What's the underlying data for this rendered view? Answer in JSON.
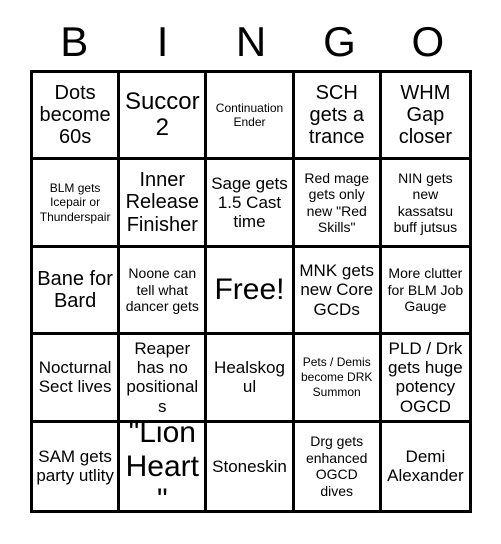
{
  "card": {
    "title": "BINGO",
    "header_letters": [
      "B",
      "I",
      "N",
      "G",
      "O"
    ],
    "free_space_label": "Free!",
    "colors": {
      "background": "#ffffff",
      "border": "#000000",
      "text": "#000000"
    },
    "grid_size": "5x5",
    "cells": [
      {
        "text": "Dots become 60s",
        "size": "lg",
        "column": "B",
        "row": 1
      },
      {
        "text": "Succor 2",
        "size": "xl",
        "column": "I",
        "row": 1
      },
      {
        "text": "Continuation Ender",
        "size": "xs",
        "column": "N",
        "row": 1
      },
      {
        "text": "SCH gets a trance",
        "size": "lg",
        "column": "G",
        "row": 1
      },
      {
        "text": "WHM Gap closer",
        "size": "lg",
        "column": "O",
        "row": 1
      },
      {
        "text": "BLM gets Icepair or Thunderspair",
        "size": "xs",
        "column": "B",
        "row": 2
      },
      {
        "text": "Inner Release Finisher",
        "size": "lg",
        "column": "I",
        "row": 2
      },
      {
        "text": "Sage gets 1.5 Cast time",
        "size": "md",
        "column": "N",
        "row": 2
      },
      {
        "text": "Red mage gets only new \"Red Skills\"",
        "size": "sm",
        "column": "G",
        "row": 2
      },
      {
        "text": "NIN gets new kassatsu buff jutsus",
        "size": "sm",
        "column": "O",
        "row": 2
      },
      {
        "text": "Bane for Bard",
        "size": "lg",
        "column": "B",
        "row": 3
      },
      {
        "text": "Noone can tell what dancer gets",
        "size": "sm",
        "column": "I",
        "row": 3
      },
      {
        "text": "Free!",
        "size": "xxl",
        "column": "N",
        "row": 3
      },
      {
        "text": "MNK gets new Core GCDs",
        "size": "md",
        "column": "G",
        "row": 3
      },
      {
        "text": "More clutter for BLM Job Gauge",
        "size": "sm",
        "column": "O",
        "row": 3
      },
      {
        "text": "Nocturnal Sect lives",
        "size": "md",
        "column": "B",
        "row": 4
      },
      {
        "text": "Reaper has no positionals",
        "size": "md",
        "column": "I",
        "row": 4
      },
      {
        "text": "Healskogul",
        "size": "md",
        "column": "N",
        "row": 4
      },
      {
        "text": "Pets / Demis become DRK Summon",
        "size": "xs",
        "column": "G",
        "row": 4
      },
      {
        "text": "PLD / Drk gets huge potency OGCD",
        "size": "md",
        "column": "O",
        "row": 4
      },
      {
        "text": "SAM gets party utlity",
        "size": "md",
        "column": "B",
        "row": 5
      },
      {
        "text": "\"Lion Heart\"",
        "size": "xxl",
        "column": "I",
        "row": 5
      },
      {
        "text": "Stoneskin",
        "size": "md",
        "column": "N",
        "row": 5
      },
      {
        "text": "Drg gets enhanced OGCD dives",
        "size": "sm",
        "column": "G",
        "row": 5
      },
      {
        "text": "Demi Alexander",
        "size": "md",
        "column": "O",
        "row": 5
      }
    ]
  }
}
